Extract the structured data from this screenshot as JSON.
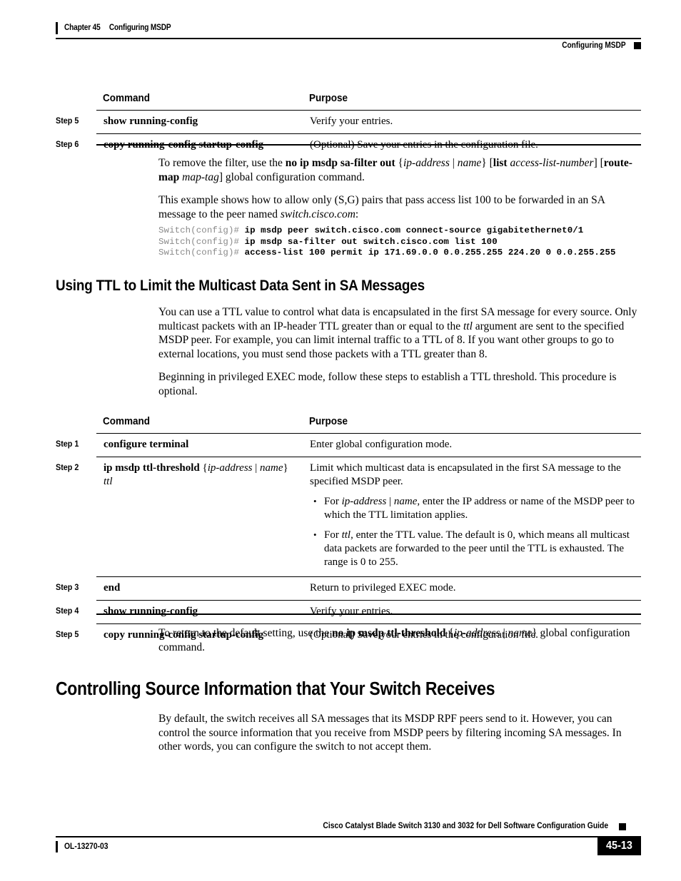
{
  "header": {
    "chapter_number": "Chapter 45",
    "chapter_title": "Configuring MSDP",
    "running_head_right": "Configuring MSDP"
  },
  "table1": {
    "columns": [
      "Command",
      "Purpose"
    ],
    "rows": [
      {
        "step": "Step 5",
        "command": "show running-config",
        "purpose": "Verify your entries."
      },
      {
        "step": "Step 6",
        "command": "copy running-config startup-config",
        "purpose": "(Optional) Save your entries in the configuration file."
      }
    ]
  },
  "para_remove_filter": {
    "t1": "To remove the filter, use the ",
    "b1": "no ip msdp sa-filter out",
    "t2": " {",
    "i1": "ip-address",
    "t3": " | ",
    "i2": "name",
    "t4": "} [",
    "b2": "list",
    "t5": " ",
    "i3": "access-list-number",
    "t6": "] [",
    "b3": "route-map",
    "t7": " ",
    "i4": "map-tag",
    "t8": "] global configuration command."
  },
  "para_example": {
    "t1": "This example shows how to allow only (S,G) pairs that pass access list 100 to be forwarded in an SA message to the peer named ",
    "i1": "switch.cisco.com",
    "t2": ":"
  },
  "code_block": {
    "lines": [
      {
        "prompt": "Switch(config)# ",
        "command": "ip msdp peer switch.cisco.com connect-source gigabitethernet0/1"
      },
      {
        "prompt": "Switch(config)# ",
        "command": "ip msdp sa-filter out switch.cisco.com list 100"
      },
      {
        "prompt": "Switch(config)# ",
        "command": "access-list 100 permit ip 171.69.0.0 0.0.255.255 224.20 0 0.0.255.255"
      }
    ]
  },
  "heading_ttl": "Using TTL to Limit the Multicast Data Sent in SA Messages",
  "para_ttl_1": {
    "t1": "You can use a TTL value to control what data is encapsulated in the first SA message for every source. Only multicast packets with an IP-header TTL greater than or equal to the ",
    "i1": "ttl",
    "t2": " argument are sent to the specified MSDP peer. For example, you can limit internal traffic to a TTL of 8. If you want other groups to go to external locations, you must send those packets with a TTL greater than 8."
  },
  "para_ttl_2": "Beginning in privileged EXEC mode, follow these steps to establish a TTL threshold. This procedure is optional.",
  "table2": {
    "columns": [
      "Command",
      "Purpose"
    ],
    "rows": [
      {
        "step": "Step 1",
        "command": "configure terminal",
        "purpose": "Enter global configuration mode."
      },
      {
        "step": "Step 2",
        "command_bold": "ip msdp ttl-threshold",
        "command_arg_open": " {",
        "command_arg_i1": "ip-address",
        "command_arg_sep": " | ",
        "command_arg_i2": "name",
        "command_arg_close": "} ",
        "command_arg_i3": "ttl",
        "purpose_intro": "Limit which multicast data is encapsulated in the first SA message to the specified MSDP peer.",
        "bullets": [
          {
            "t1": "For ",
            "i1": "ip-address",
            "t2": " | ",
            "i2": "name",
            "t3": ", enter the IP address or name of the MSDP peer to which the TTL limitation applies."
          },
          {
            "t1": "For ",
            "i1": "ttl",
            "t2": ", enter the TTL value. The default is 0, which means all multicast data packets are forwarded to the peer until the TTL is exhausted. The range is 0 to 255."
          }
        ]
      },
      {
        "step": "Step 3",
        "command": "end",
        "purpose": "Return to privileged EXEC mode."
      },
      {
        "step": "Step 4",
        "command": "show running-config",
        "purpose": "Verify your entries."
      },
      {
        "step": "Step 5",
        "command": "copy running-config startup-config",
        "purpose": "(Optional) Save your entries in the configuration file."
      }
    ]
  },
  "para_default": {
    "t1": "To return to the default setting, use the ",
    "b1": "no ip msdp ttl-threshold",
    "t2": " {",
    "i1": "ip-address",
    "t3": " | ",
    "i2": "name",
    "t4": "} global configuration command."
  },
  "heading_controlling": "Controlling Source Information that Your Switch Receives",
  "para_controlling": "By default, the switch receives all SA messages that its MSDP RPF peers send to it. However, you can control the source information that you receive from MSDP peers by filtering incoming SA messages. In other words, you can configure the switch to not accept them.",
  "footer": {
    "guide_title": "Cisco Catalyst Blade Switch 3130 and 3032 for Dell Software Configuration Guide",
    "doc_number": "OL-13270-03",
    "page_number": "45-13"
  }
}
